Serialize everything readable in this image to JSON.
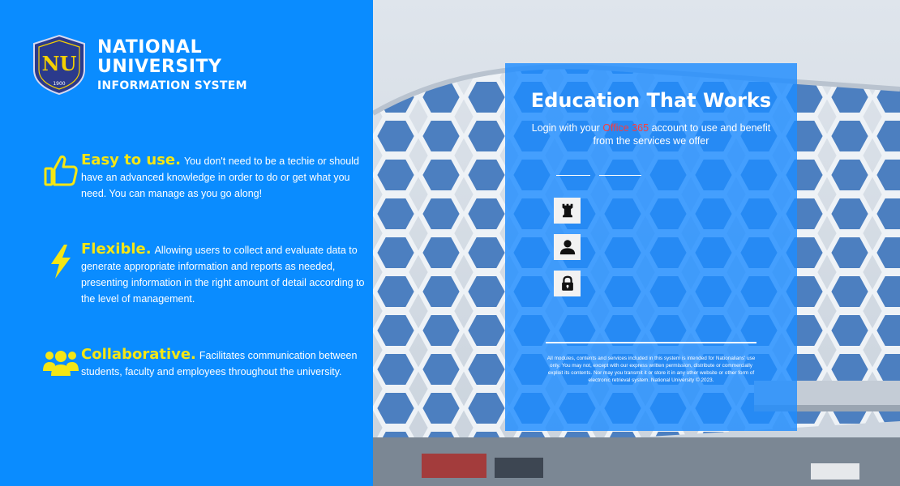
{
  "brand": {
    "line1": "NATIONAL",
    "line2": "UNIVERSITY",
    "line3": "INFORMATION SYSTEM",
    "seal_year": "1900",
    "seal_letters": "NU",
    "colors": {
      "navy": "#2b3a8c",
      "gold": "#f5d000"
    }
  },
  "features": [
    {
      "icon": "thumbs-up-icon",
      "heading": "Easy to use.",
      "body": "You don't need to be a techie or should have an advanced knowledge in order to do or get what you need. You can manage as you go along!"
    },
    {
      "icon": "lightning-icon",
      "heading": "Flexible.",
      "body": "Allowing users to collect and evaluate data to generate appropriate information and reports as needed, presenting information in the right amount of detail according to the level of management."
    },
    {
      "icon": "group-icon",
      "heading": "Collaborative.",
      "body": "Facilitates communication between students, faculty and employees throughout the university."
    }
  ],
  "login": {
    "title": "Education That Works",
    "subtitle_pre": "Login with your",
    "subtitle_highlight": "Office 365",
    "subtitle_post": "account to use  and benefit from the services we offer",
    "buttons": [
      {
        "icon": "rook-icon"
      },
      {
        "icon": "user-icon"
      },
      {
        "icon": "lock-icon"
      }
    ],
    "legal": "All modules, contents and services included in this system is intended for Nationalians' use only. You may not, except with our express written permission, distribute or commercially exploit its contents. Nor may you transmit it or store it in any other website or other form of electronic retrieval system. National University © 2023."
  },
  "colors": {
    "left_bg": "#0a8cff",
    "card_bg": "#1e8cff",
    "feature_heading": "#f5e614",
    "highlight": "#ff3a3a"
  }
}
